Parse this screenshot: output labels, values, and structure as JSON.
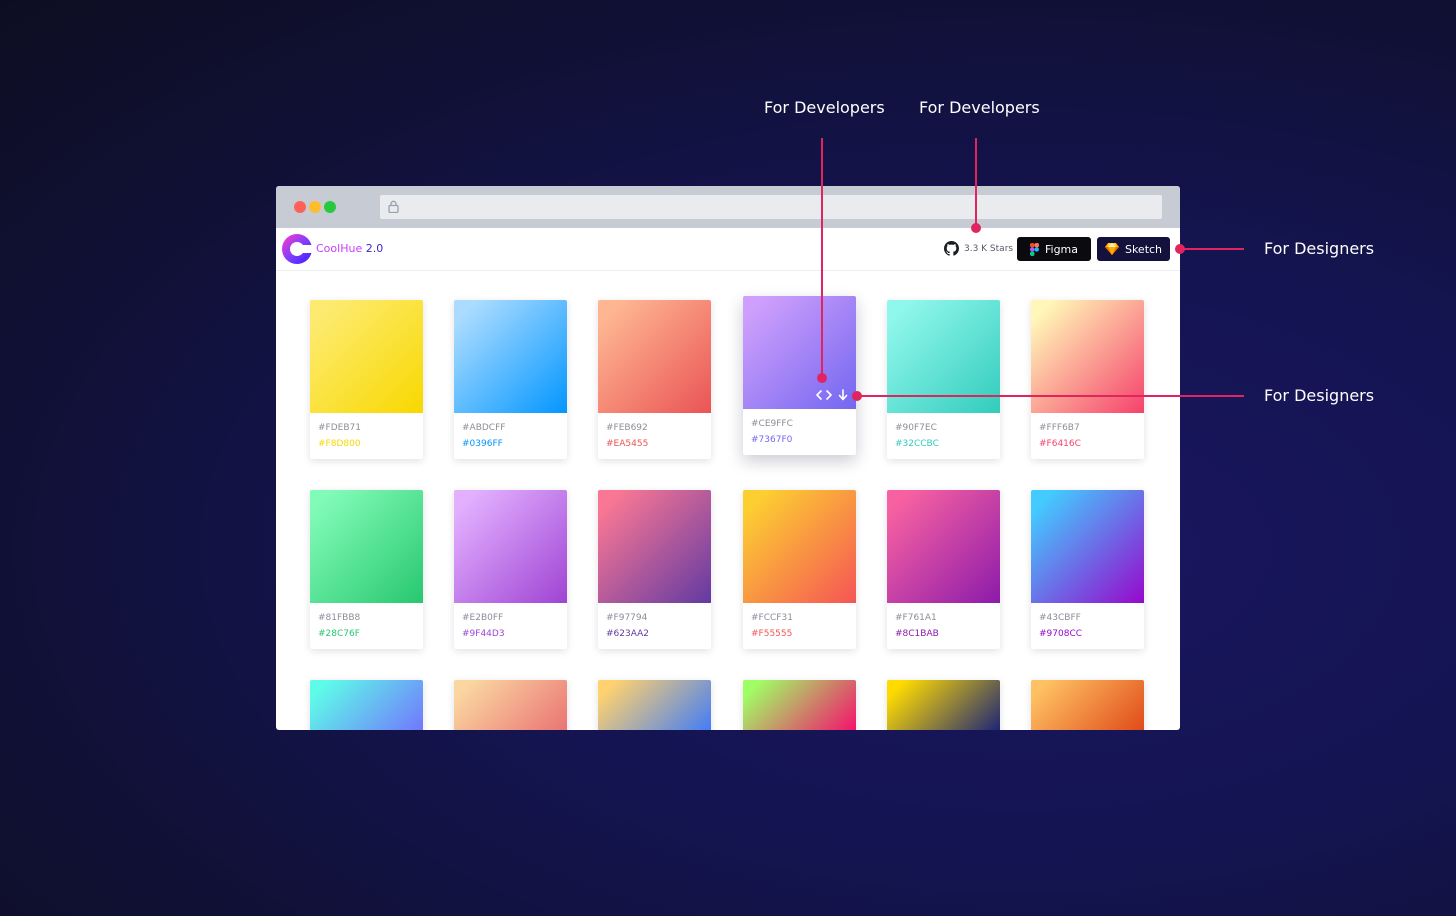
{
  "annotations": {
    "dev_label_1": "For Developers",
    "dev_label_2": "For Developers",
    "designer_label_1": "For Designers",
    "designer_label_2": "For Designers",
    "line_color": "#e0245e"
  },
  "browser": {
    "traffic_lights": [
      "#ff6159",
      "#ffbd2e",
      "#28c941"
    ]
  },
  "header": {
    "brand_name": "CoolHue",
    "brand_version": " 2.0",
    "stars_text": "3.3 K Stars",
    "figma_label": "Figma",
    "sketch_label": "Sketch"
  },
  "gradients": [
    {
      "from": "#FDEB71",
      "to": "#F8D800"
    },
    {
      "from": "#ABDCFF",
      "to": "#0396FF"
    },
    {
      "from": "#FEB692",
      "to": "#EA5455"
    },
    {
      "from": "#CE9FFC",
      "to": "#7367F0"
    },
    {
      "from": "#90F7EC",
      "to": "#32CCBC"
    },
    {
      "from": "#FFF6B7",
      "to": "#F6416C"
    },
    {
      "from": "#81FBB8",
      "to": "#28C76F"
    },
    {
      "from": "#E2B0FF",
      "to": "#9F44D3"
    },
    {
      "from": "#F97794",
      "to": "#623AA2"
    },
    {
      "from": "#FCCF31",
      "to": "#F55555"
    },
    {
      "from": "#F761A1",
      "to": "#8C1BAB"
    },
    {
      "from": "#43CBFF",
      "to": "#9708CC"
    }
  ],
  "partial_gradients": [
    {
      "from": "#5EFCE8",
      "to": "#736EFE"
    },
    {
      "from": "#FAD7A1",
      "to": "#E96D71"
    },
    {
      "from": "#FFD26F",
      "to": "#3677FF"
    },
    {
      "from": "#A0FE65",
      "to": "#FA016D"
    },
    {
      "from": "#FFDB01",
      "to": "#0E197D"
    },
    {
      "from": "#FEC163",
      "to": "#DE4313"
    }
  ]
}
